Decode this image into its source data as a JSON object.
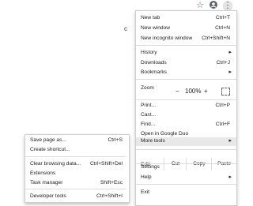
{
  "menu": {
    "items": [
      {
        "label": "New tab",
        "shortcut": "Ctrl+T"
      },
      {
        "label": "New window",
        "shortcut": "Ctrl+N"
      },
      {
        "label": "New incognito window",
        "shortcut": "Ctrl+Shift+N"
      },
      {
        "label": "History",
        "has_submenu": true
      },
      {
        "label": "Downloads",
        "shortcut": "Ctrl+J"
      },
      {
        "label": "Bookmarks",
        "has_submenu": true
      },
      {
        "label": "Print...",
        "shortcut": "Ctrl+P"
      },
      {
        "label": "Cast..."
      },
      {
        "label": "Find...",
        "shortcut": "Ctrl+F"
      },
      {
        "label": "Open in Google Duo"
      },
      {
        "label": "More tools",
        "has_submenu": true
      },
      {
        "label": "Settings"
      },
      {
        "label": "Help",
        "has_submenu": true
      },
      {
        "label": "Exit"
      }
    ],
    "zoom": {
      "label": "Zoom",
      "minus": "−",
      "value": "100%",
      "plus": "+"
    },
    "edit": {
      "label": "Edit",
      "cut": "Cut",
      "copy": "Copy",
      "paste": "Paste"
    }
  },
  "submenu": {
    "items": [
      {
        "label": "Save page as...",
        "shortcut": "Ctrl+S"
      },
      {
        "label": "Create shortcut..."
      },
      {
        "label": "Clear browsing data...",
        "shortcut": "Ctrl+Shift+Del"
      },
      {
        "label": "Extensions"
      },
      {
        "label": "Task manager",
        "shortcut": "Shift+Esc"
      },
      {
        "label": "Developer tools",
        "shortcut": "Ctrl+Shift+I"
      }
    ]
  },
  "icons": {
    "star": "star-icon",
    "account": "account-icon",
    "menu": "kebab-menu-icon"
  },
  "colors": {
    "highlight": "#e8e8e8",
    "separator": "#dadce0",
    "icon": "#5f6368"
  }
}
